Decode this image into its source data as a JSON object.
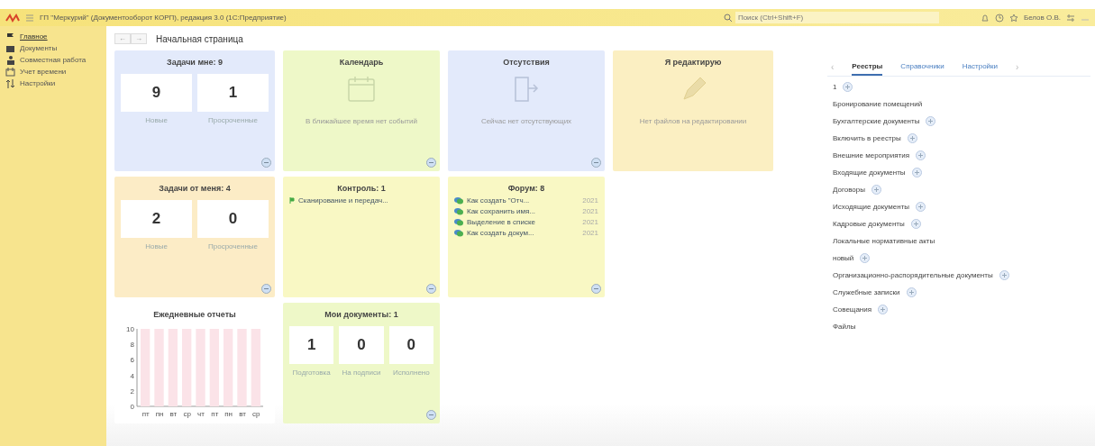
{
  "window": {
    "title": "ГП \"Меркурий\" (Документооборот КОРП), редакция 3.0 (1С:Предприятие)",
    "search": {
      "placeholder": "Поиск (Ctrl+Shift+F)"
    },
    "user": "Белов О.В."
  },
  "sidebar": {
    "items": [
      {
        "label": "Главное",
        "selected": true
      },
      {
        "label": "Документы",
        "selected": false
      },
      {
        "label": "Совместная работа",
        "selected": false
      },
      {
        "label": "Учет времени",
        "selected": false
      },
      {
        "label": "Настройки",
        "selected": false
      }
    ]
  },
  "page": {
    "back": "←",
    "forward": "→",
    "title": "Начальная страница"
  },
  "widgets": [
    {
      "kind": "counters",
      "title": "Задачи мне: 9",
      "color": "#e3eafb",
      "more": true,
      "counters": [
        {
          "value": "9",
          "label": "Новые"
        },
        {
          "value": "1",
          "label": "Просроченные"
        }
      ]
    },
    {
      "kind": "calendar",
      "title": "Календарь",
      "color": "#eef8c8",
      "more": true,
      "message": "В ближайшее время нет событий"
    },
    {
      "kind": "absence",
      "title": "Отсутствия",
      "color": "#e3eafb",
      "more": true,
      "message": "Сейчас нет отсутствующих"
    },
    {
      "kind": "editing",
      "title": "Я редактирую",
      "color": "#fbefc2",
      "message": "Нет файлов на редактировании",
      "more": false
    },
    {
      "kind": "counters",
      "title": "Задачи от меня: 4",
      "color": "#fcecc6",
      "more": true,
      "counters": [
        {
          "value": "2",
          "label": "Новые"
        },
        {
          "value": "0",
          "label": "Просроченные"
        }
      ]
    },
    {
      "kind": "list",
      "title": "Контроль: 1",
      "color": "#f9f8c4",
      "more": true,
      "items": [
        {
          "text": "Сканирование и передач..."
        }
      ]
    },
    {
      "kind": "forum",
      "title": "Форум: 8",
      "color": "#f9f8c4",
      "more": true,
      "items": [
        {
          "text": "Как создать \"Отч...",
          "date": "2021"
        },
        {
          "text": "Как сохранить имя...",
          "date": "2021"
        },
        {
          "text": "Выделение в списке",
          "date": "2021"
        },
        {
          "text": "Как создать докум...",
          "date": "2021"
        }
      ]
    },
    {
      "kind": "spacer"
    },
    {
      "kind": "chart",
      "title": "Ежедневные отчеты",
      "color": "#ffffff",
      "more": false,
      "chart_data": {
        "type": "bar",
        "categories": [
          "пт",
          "пн",
          "вт",
          "ср",
          "чт",
          "пт",
          "пн",
          "вт",
          "ср"
        ],
        "values": [
          10,
          10,
          10,
          10,
          10,
          10,
          10,
          10,
          10
        ],
        "ylim": [
          0,
          10
        ],
        "yticks": [
          0,
          2,
          4,
          6,
          8,
          10
        ]
      }
    },
    {
      "kind": "counters",
      "title": "Мои документы: 1",
      "color": "#eef8c8",
      "more": true,
      "counters": [
        {
          "value": "1",
          "label": "Подготовка"
        },
        {
          "value": "0",
          "label": "На подписи"
        },
        {
          "value": "0",
          "label": "Исполнено"
        }
      ]
    }
  ],
  "registry": {
    "prev": "‹",
    "next": "›",
    "tabs": [
      {
        "label": "Реестры",
        "selected": true
      },
      {
        "label": "Справочники",
        "selected": false
      },
      {
        "label": "Настройки",
        "selected": false
      }
    ],
    "items": [
      {
        "label": "1",
        "badge": true
      },
      {
        "label": "Бронирование помещений",
        "badge": false
      },
      {
        "label": "Бухгалтерские документы",
        "badge": true
      },
      {
        "label": "Включить в реестры",
        "badge": true
      },
      {
        "label": "Внешние мероприятия",
        "badge": true
      },
      {
        "label": "Входящие документы",
        "badge": true
      },
      {
        "label": "Договоры",
        "badge": true
      },
      {
        "label": "Исходящие документы",
        "badge": true
      },
      {
        "label": "Кадровые документы",
        "badge": true
      },
      {
        "label": "Локальные нормативные акты",
        "badge": false
      },
      {
        "label": "новый",
        "badge": true
      },
      {
        "label": "Организационно-распорядительные документы",
        "badge": true
      },
      {
        "label": "Служебные записки",
        "badge": true
      },
      {
        "label": "Совещания",
        "badge": true
      },
      {
        "label": "Файлы",
        "badge": false
      }
    ]
  }
}
